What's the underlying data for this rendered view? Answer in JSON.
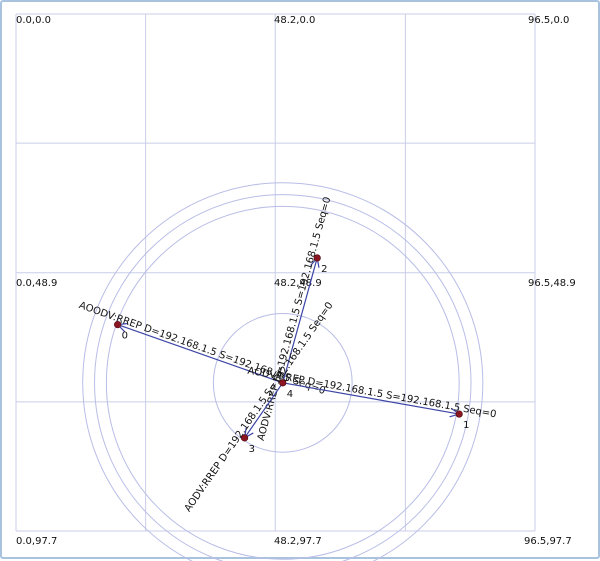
{
  "window": {
    "title": ""
  },
  "coordinate_labels": {
    "top_left": "0.0,0.0",
    "top_center": "48.2,0.0",
    "top_right": "96.5,0.0",
    "mid_left": "0.0,48.9",
    "mid_center": "48.2,48.9",
    "mid_right": "96.5,48.9",
    "bottom_left": "0.0,97.7",
    "bottom_center": "48.2,97.7",
    "bottom_right": "96.5,97.7"
  },
  "nodes": [
    {
      "id": "0",
      "label": "0",
      "x": 18.9,
      "y": 58.7
    },
    {
      "id": "1",
      "label": "1",
      "x": 82.4,
      "y": 75.6
    },
    {
      "id": "2",
      "label": "2",
      "x": 56.0,
      "y": 46.1
    },
    {
      "id": "3",
      "label": "3",
      "x": 42.5,
      "y": 80.1
    },
    {
      "id": "4",
      "label": "4",
      "x": 49.6,
      "y": 69.7
    }
  ],
  "ranges": {
    "center_node": "4",
    "radii": [
      12.9,
      32.8,
      35.0,
      37.2
    ]
  },
  "messages": [
    {
      "from": "4",
      "to": "0",
      "text": "AOODV:RREP D=192.168.1.5 S=192.168.1.5 Seq=0"
    },
    {
      "from": "4",
      "to": "1",
      "text": "AODV:RREP D=192.168.1.5 S=192.168.1.5 Seq=0"
    },
    {
      "from": "4",
      "to": "2",
      "text": "AODV:RREP D=192.168.1.5 S=192.168.1.5 Seq=0"
    },
    {
      "from": "4",
      "to": "3",
      "text": "AODV:RREP D=192.168.1.5 S=192.168.1.5 Seq=0"
    }
  ],
  "colors": {
    "grid": "#c9cde8",
    "range_circle": "#b8bde6",
    "link": "#3c45a6",
    "node": "#8b1520"
  }
}
